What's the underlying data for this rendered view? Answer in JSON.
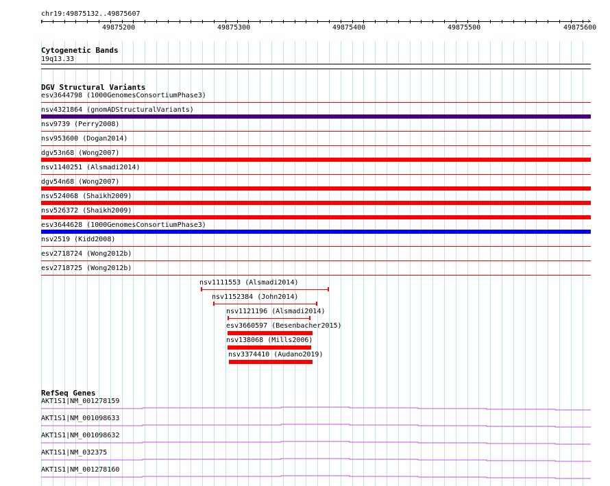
{
  "ruler": {
    "range_label": "chr19:49875132..49875607",
    "ticks": [
      "49875200",
      "49875300",
      "49875400",
      "49875500",
      "49875600"
    ]
  },
  "cytoband": {
    "title": "Cytogenetic Bands",
    "band": "19q13.33"
  },
  "dgv": {
    "title": "DGV Structural Variants",
    "rows": [
      {
        "label": "esv3644798 (1000GenomesConsortiumPhase3)",
        "color": "#ff0000",
        "thick": false
      },
      {
        "label": "nsv4321864 (gnomADStructuralVariants)",
        "color": "#4b0082",
        "thick": true
      },
      {
        "label": "nsv9739 (Perry2008)",
        "color": "#ff0000",
        "thick": false
      },
      {
        "label": "nsv953600 (Dogan2014)",
        "color": "#ff0000",
        "thick": false
      },
      {
        "label": "dgv53n68 (Wong2007)",
        "color": "#ff0000",
        "thick": true
      },
      {
        "label": "nsv1140251 (Alsmadi2014)",
        "color": "#ff0000",
        "thick": false
      },
      {
        "label": "dgv54n68 (Wong2007)",
        "color": "#ff0000",
        "thick": true
      },
      {
        "label": "nsv524068 (Shaikh2009)",
        "color": "#ff0000",
        "thick": true
      },
      {
        "label": "nsv526372 (Shaikh2009)",
        "color": "#ff0000",
        "thick": true
      },
      {
        "label": "esv3644628 (1000GenomesConsortiumPhase3)",
        "color": "#0000ff",
        "thick": true
      },
      {
        "label": "nsv2519 (Kidd2008)",
        "color": "#ff0000",
        "thick": false
      },
      {
        "label": "esv2718724 (Wong2012b)",
        "color": "#ff0000",
        "thick": false
      },
      {
        "label": "esv2718725 (Wong2012b)",
        "color": "#ff0000",
        "thick": false
      }
    ],
    "short_variants": [
      {
        "label": "nsv1111553 (Alsmadi2014)",
        "style": "thin"
      },
      {
        "label": "nsv1152384 (John2014)",
        "style": "thin"
      },
      {
        "label": "nsv1121196 (Alsmadi2014)",
        "style": "thin"
      },
      {
        "label": "esv3660597 (Besenbacher2015)",
        "style": "thick"
      },
      {
        "label": "nsv138068 (Mills2006)",
        "style": "thick"
      },
      {
        "label": "nsv3374410 (Audano2019)",
        "style": "thick"
      }
    ]
  },
  "refseq": {
    "title": "RefSeq Genes",
    "genes": [
      {
        "label": "AKT1S1|NM_001278159"
      },
      {
        "label": "AKT1S1|NM_001098633"
      },
      {
        "label": "AKT1S1|NM_001098632"
      },
      {
        "label": "AKT1S1|NM_032375"
      },
      {
        "label": "AKT1S1|NM_001278160"
      }
    ],
    "color": "#c050e0"
  }
}
